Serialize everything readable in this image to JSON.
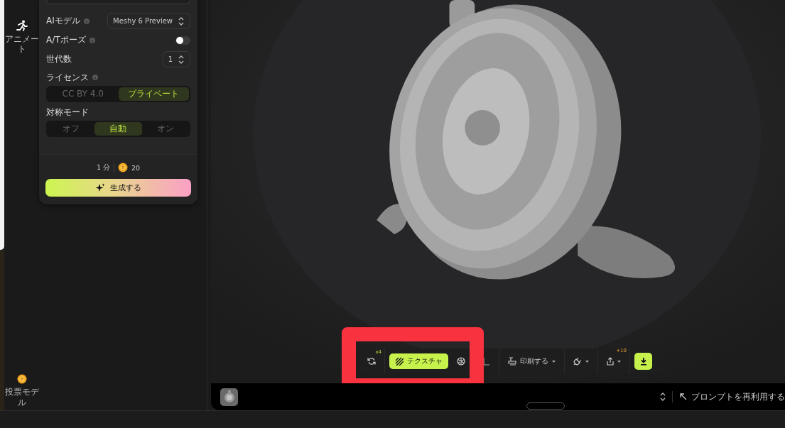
{
  "sidebar": {
    "items": [
      {
        "kind": "animate",
        "label": "アニメート"
      },
      {
        "kind": "vote",
        "label": "投票モデル"
      }
    ]
  },
  "panel": {
    "fields": [
      {
        "kind": "select",
        "label": "AIモデル",
        "info": true,
        "value": "Meshy 6 Preview"
      },
      {
        "kind": "toggle",
        "label": "A/Tポーズ",
        "info": true,
        "on": false
      },
      {
        "kind": "stepper",
        "label": "世代数",
        "info": false,
        "value": "1"
      }
    ],
    "license": {
      "label": "ライセンス",
      "info": true,
      "options": [
        {
          "label": "CC BY 4.0",
          "selected": false
        },
        {
          "label": "プライベート",
          "selected": true
        }
      ]
    },
    "symmetry": {
      "label": "対称モード",
      "info": false,
      "options": [
        {
          "label": "オフ",
          "selected": false
        },
        {
          "label": "自動",
          "selected": true
        },
        {
          "label": "オン",
          "selected": false
        }
      ]
    },
    "time": "1 分",
    "cost": "20",
    "generate_button": "生成する"
  },
  "toolbar": {
    "remesh_badge": "x4",
    "texture_button": {
      "label": "テクスチャ",
      "selected": true
    },
    "print_button": "印刷する",
    "share_badge": "+10"
  },
  "bottom_bar": {
    "reuse_prompt": "プロンプトを再利用する"
  }
}
